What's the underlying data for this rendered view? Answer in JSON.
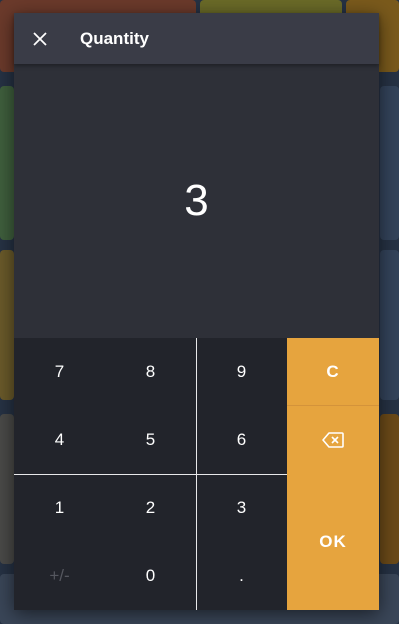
{
  "dialog": {
    "title": "Quantity",
    "display_value": "3"
  },
  "keypad": {
    "row1": [
      "7",
      "8",
      "9"
    ],
    "row2": [
      "4",
      "5",
      "6"
    ],
    "row3": [
      "1",
      "2",
      "3"
    ],
    "row4": [
      "+/-",
      "0",
      "."
    ],
    "clear_label": "C",
    "ok_label": "OK"
  },
  "icons": {
    "close": "close-icon",
    "backspace": "backspace-icon"
  },
  "colors": {
    "accent": "#e6a43e",
    "dialog_bg": "#2e3038",
    "header_bg": "#3a3c47",
    "keypad_bg": "#22242b",
    "disabled_text": "#55575f"
  }
}
